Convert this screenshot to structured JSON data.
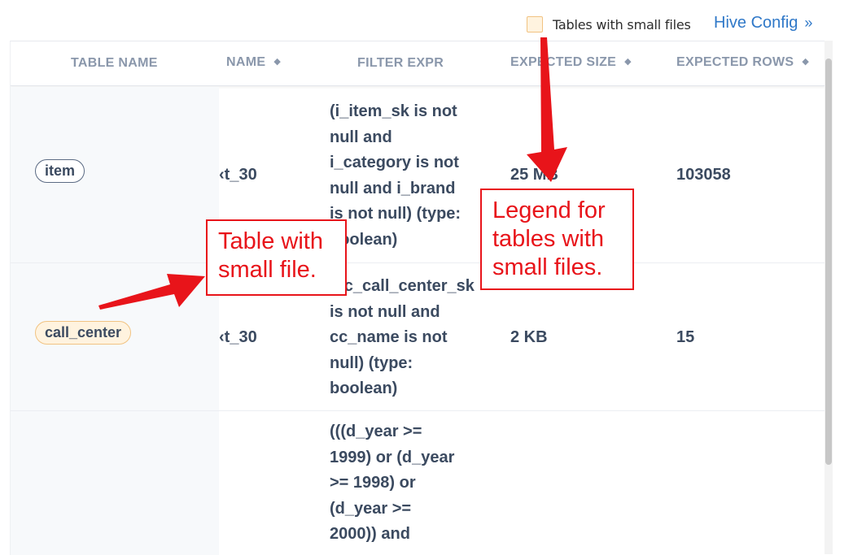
{
  "header": {
    "legend_label": "Tables with small files",
    "hive_config_link": "Hive Config",
    "hive_config_chevron": "»"
  },
  "table": {
    "columns": [
      {
        "label": "TABLE NAME",
        "sortable": false
      },
      {
        "label": "NAME",
        "sortable": true
      },
      {
        "label": "FILTER EXPR",
        "sortable": false
      },
      {
        "label": "EXPECTED SIZE",
        "sortable": true
      },
      {
        "label": "EXPECTED ROWS",
        "sortable": true
      }
    ],
    "sort_glyph": "◆",
    "rows": [
      {
        "table_name": "item",
        "small_files": false,
        "name": "‹t_30",
        "filter_expr": "(i_item_sk is not\nnull and\ni_category is not\nnull and i_brand\nis not null) (type:\nboolean)",
        "expected_size": "25 MB",
        "expected_rows": "103058"
      },
      {
        "table_name": "call_center",
        "small_files": true,
        "name": "‹t_30",
        "filter_expr": "(cc_call_center_sk\nis not null and\ncc_name is not\nnull) (type:\nboolean)",
        "expected_size": "2 KB",
        "expected_rows": "15"
      },
      {
        "table_name": "",
        "small_files": false,
        "name": "",
        "filter_expr": "(((d_year >=\n1999) or (d_year\n>= 1998) or\n(d_year >=\n2000)) and",
        "expected_size": "",
        "expected_rows": ""
      }
    ]
  },
  "annotations": {
    "legend_callout": "Legend for\ntables with\nsmall files.",
    "table_callout": "Table with\nsmall file."
  },
  "colors": {
    "small_file_fill": "#fff3df",
    "small_file_border": "#f1c382",
    "link": "#2f78c8",
    "annotation_red": "#e8141a"
  }
}
